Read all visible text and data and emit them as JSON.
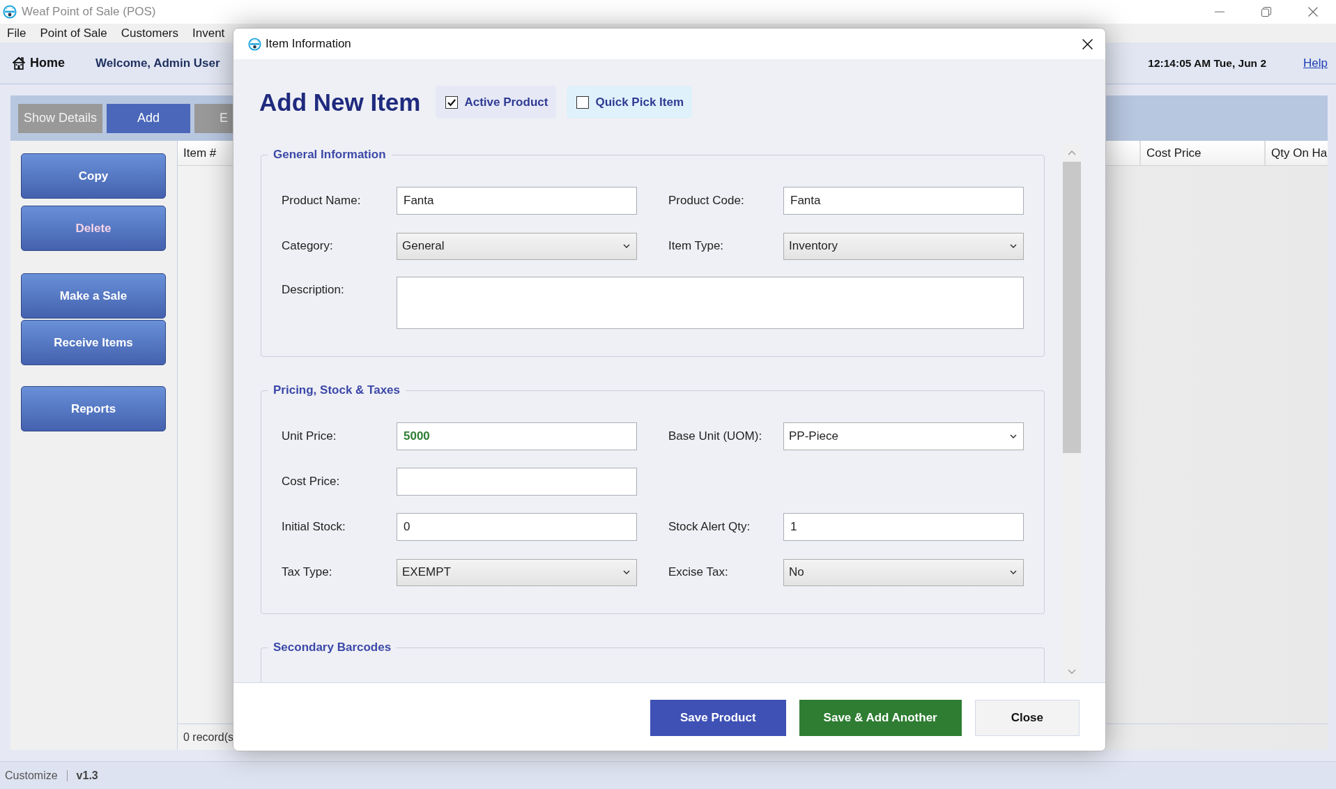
{
  "window": {
    "title": "Weaf Point of Sale (POS)"
  },
  "menu": [
    "File",
    "Point of Sale",
    "Customers",
    "Invent"
  ],
  "header": {
    "home": "Home",
    "welcome": "Welcome, Admin User",
    "datetime": "12:14:05 AM Tue, Jun 2",
    "help": "Help"
  },
  "toolbar": [
    {
      "label": "Show Details",
      "kind": "plain"
    },
    {
      "label": "Add",
      "kind": "primary"
    },
    {
      "label": "E",
      "kind": "plain"
    }
  ],
  "sidebar": {
    "groups": [
      {
        "buttons": [
          {
            "label": "Copy",
            "kind": "normal"
          },
          {
            "label": "Delete",
            "kind": "danger"
          }
        ]
      },
      {
        "buttons": [
          {
            "label": "Make a Sale",
            "kind": "normal"
          },
          {
            "label": "Receive Items",
            "kind": "normal"
          }
        ]
      },
      {
        "buttons": [
          {
            "label": "Reports",
            "kind": "normal"
          }
        ]
      }
    ]
  },
  "grid": {
    "columns": [
      "Item #",
      "Cost Price",
      "Qty On Ha"
    ],
    "footer": "0 record(s"
  },
  "status_bar": {
    "link": "Customize",
    "version": "v1.3"
  },
  "dialog": {
    "title": "Item Information",
    "heading": "Add New Item",
    "options": [
      {
        "label": "Active Product",
        "checked": true,
        "color": "#e6e8f5"
      },
      {
        "label": "Quick Pick Item",
        "checked": false,
        "color": "#dff1fb"
      }
    ],
    "sections": [
      {
        "title": "General Information",
        "rows": [
          [
            {
              "label": "Product Name:",
              "kind": "text",
              "value": "Fanta"
            },
            {
              "label": "Product Code:",
              "kind": "text",
              "value": "Fanta"
            }
          ],
          [
            {
              "label": "Category:",
              "kind": "select",
              "value": "General"
            },
            {
              "label": "Item Type:",
              "kind": "select",
              "value": "Inventory"
            }
          ],
          [
            {
              "label": "Description:",
              "kind": "textarea"
            }
          ]
        ]
      },
      {
        "title": "Pricing, Stock & Taxes",
        "rows": [
          [
            {
              "label": "Unit Price:",
              "kind": "price",
              "value": "5000"
            },
            {
              "label": "Base Unit (UOM):",
              "kind": "combo",
              "value": "PP-Piece"
            }
          ],
          [
            {
              "label": "Cost Price:",
              "kind": "text"
            }
          ],
          [
            {
              "label": "Initial Stock:",
              "kind": "text",
              "value": "0"
            },
            {
              "label": "Stock Alert Qty:",
              "kind": "text",
              "value": "1"
            }
          ],
          [
            {
              "label": "Tax Type:",
              "kind": "select",
              "value": "EXEMPT"
            },
            {
              "label": "Excise Tax:",
              "kind": "select",
              "value": "No"
            }
          ]
        ]
      },
      {
        "title": "Secondary Barcodes"
      }
    ],
    "buttons": [
      {
        "label": "Save Product",
        "kind": "primary"
      },
      {
        "label": "Save & Add Another",
        "kind": "success"
      },
      {
        "label": "Close",
        "kind": "plain"
      }
    ]
  }
}
